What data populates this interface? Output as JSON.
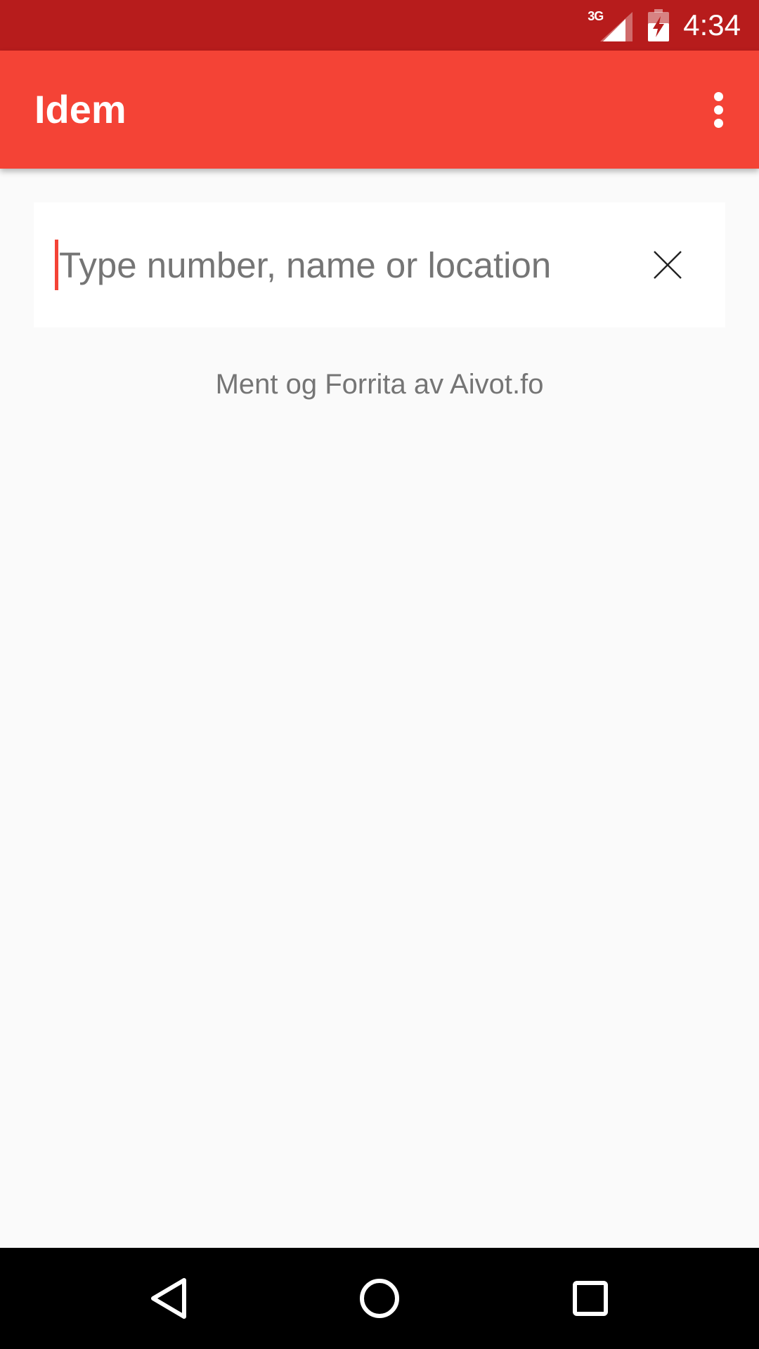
{
  "status_bar": {
    "network_label": "3G",
    "time": "4:34",
    "icons": [
      "signal-icon",
      "battery-charging-icon"
    ]
  },
  "app_bar": {
    "title": "Idem",
    "menu_icon": "more-vert-icon"
  },
  "search": {
    "value": "",
    "placeholder": "Type number, name or location",
    "clear_icon": "close-icon"
  },
  "credit": "Ment og Forrita av Aivot.fo",
  "nav_bar": {
    "icons": [
      "back-icon",
      "home-icon",
      "recents-icon"
    ]
  },
  "colors": {
    "status_bar": "#B71C1C",
    "primary": "#F44336",
    "background": "#FAFAFA",
    "card": "#FFFFFF",
    "secondary_text": "#757575"
  }
}
